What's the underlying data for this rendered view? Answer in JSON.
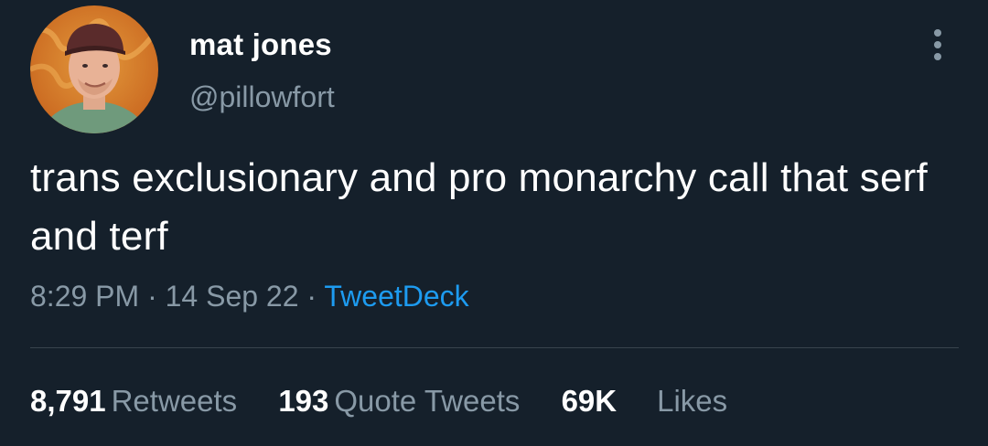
{
  "user": {
    "display_name": "mat jones",
    "handle": "@pillowfort"
  },
  "tweet": {
    "text": "trans exclusionary and pro monarchy call that serf and terf",
    "time": "8:29 PM",
    "date": "14 Sep 22",
    "source": "TweetDeck",
    "separator": "·"
  },
  "stats": {
    "retweets_count": "8,791",
    "retweets_label": "Retweets",
    "quotes_count": "193",
    "quotes_label": "Quote Tweets",
    "likes_count": "69K",
    "likes_label": "Likes"
  },
  "icons": {
    "more": "more-vertical-icon"
  },
  "colors": {
    "background": "#15202b",
    "primary_text": "#ffffff",
    "secondary_text": "#8899a6",
    "accent": "#1d9bf0"
  }
}
